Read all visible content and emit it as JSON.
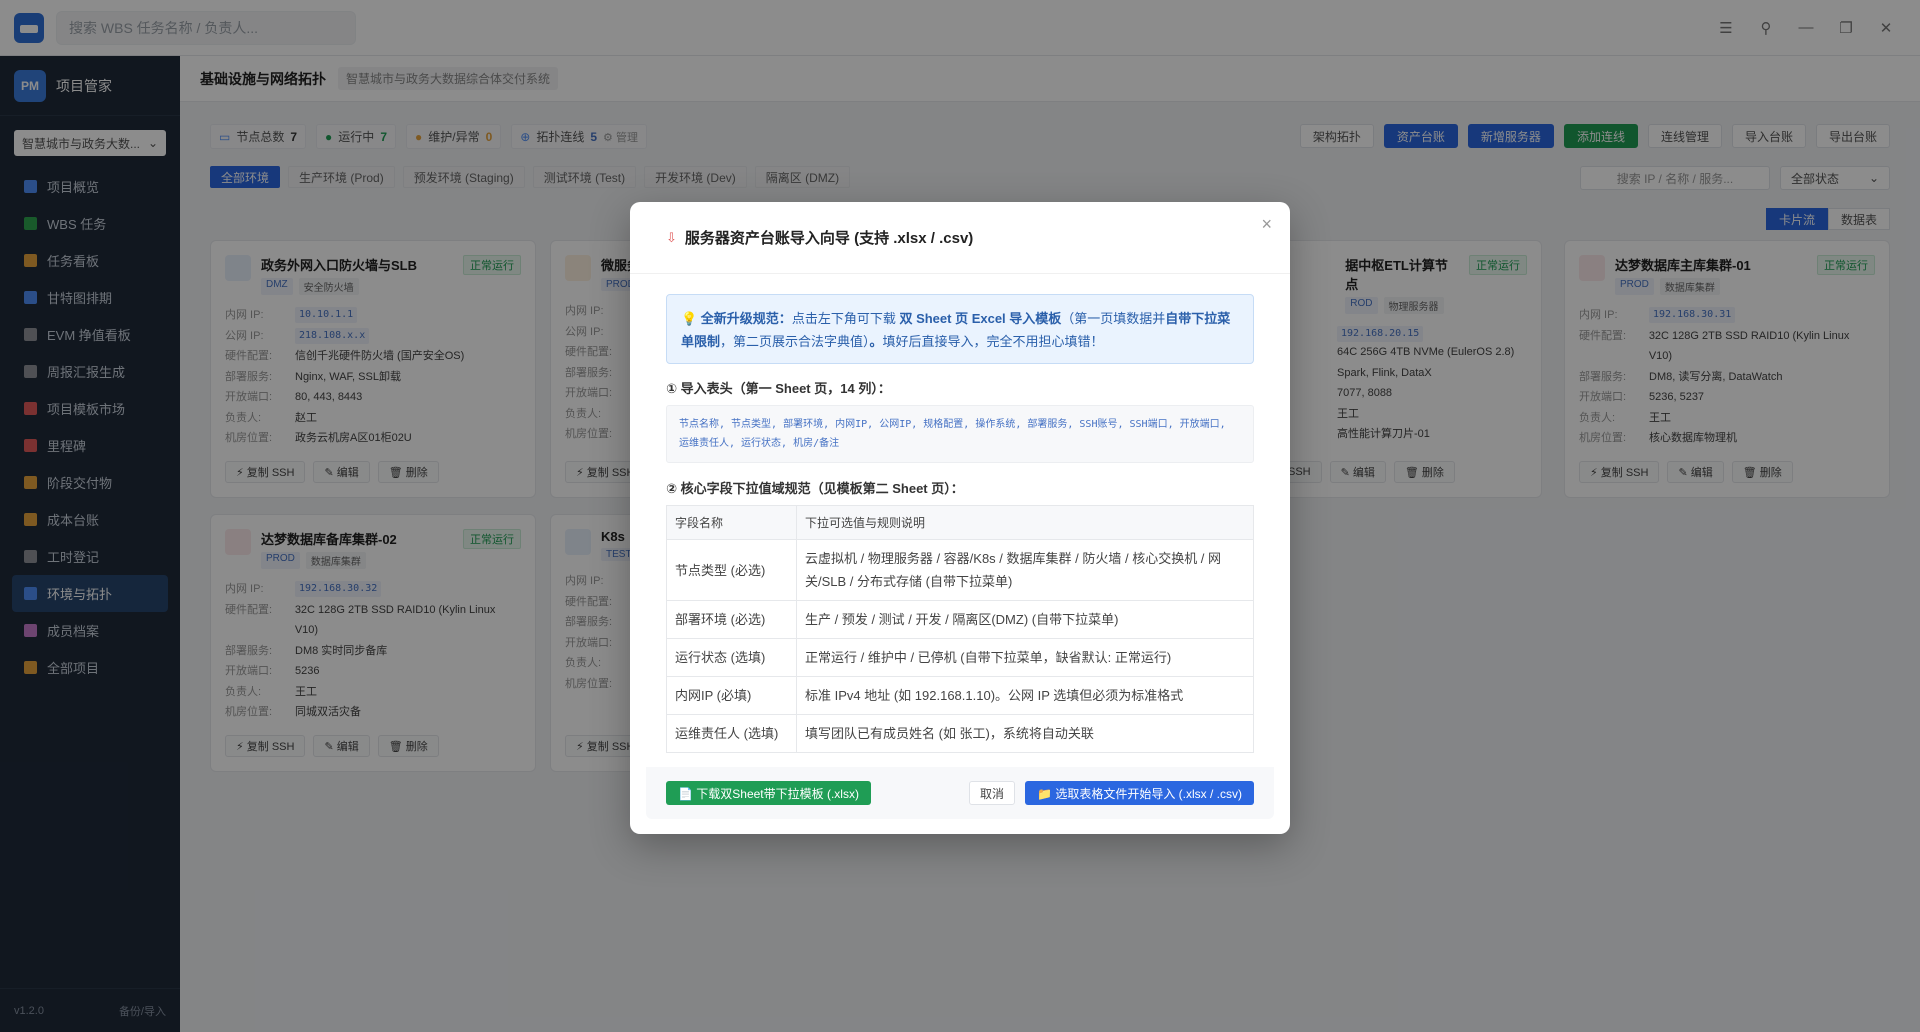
{
  "titlebar": {
    "search_placeholder": "搜索 WBS 任务名称 / 负责人...",
    "ctrl_menu": "☰",
    "ctrl_pin": "⚲",
    "ctrl_min": "—",
    "ctrl_max": "❐",
    "ctrl_close": "✕"
  },
  "sidebar": {
    "brand_logo": "PM",
    "brand_name": "项目管家",
    "project_select": "智慧城市与政务大数...",
    "items": [
      {
        "label": "项目概览",
        "color": "#4f8ef7"
      },
      {
        "label": "WBS 任务",
        "color": "#2ea44f"
      },
      {
        "label": "任务看板",
        "color": "#e6a23c"
      },
      {
        "label": "甘特图排期",
        "color": "#4f8ef7"
      },
      {
        "label": "EVM 挣值看板",
        "color": "#909399"
      },
      {
        "label": "周报汇报生成",
        "color": "#909399"
      },
      {
        "label": "项目模板市场",
        "color": "#e05a5a"
      },
      {
        "label": "里程碑",
        "color": "#e05a5a"
      },
      {
        "label": "阶段交付物",
        "color": "#e6a23c"
      },
      {
        "label": "成本台账",
        "color": "#e6a23c"
      },
      {
        "label": "工时登记",
        "color": "#909399"
      },
      {
        "label": "环境与拓扑",
        "color": "#4f8ef7"
      },
      {
        "label": "成员档案",
        "color": "#c77dcc"
      },
      {
        "label": "全部项目",
        "color": "#e6a23c"
      }
    ],
    "version": "v1.2.0",
    "backup": "备份/导入"
  },
  "page": {
    "title": "基础设施与网络拓扑",
    "subtitle": "智慧城市与政务大数据综合体交付系统"
  },
  "stats": [
    {
      "label": "节点总数",
      "value": "7"
    },
    {
      "label": "运行中",
      "value": "7"
    },
    {
      "label": "维护/异常",
      "value": "0"
    },
    {
      "label": "拓扑连线",
      "value": "5"
    }
  ],
  "stats_manage": "⚙ 管理",
  "toolbar": {
    "arch": "架构拓扑",
    "asset": "资产台账",
    "add_server": "新增服务器",
    "add_link": "添加连线",
    "link_manage": "连线管理",
    "import": "导入台账",
    "export": "导出台账"
  },
  "env_tabs": [
    "全部环境",
    "生产环境 (Prod)",
    "预发环境 (Staging)",
    "测试环境 (Test)",
    "开发环境 (Dev)",
    "隔离区 (DMZ)"
  ],
  "filter": {
    "search_placeholder": "搜索 IP / 名称 / 服务...",
    "status": "全部状态"
  },
  "view": {
    "card": "卡片流",
    "table": "数据表"
  },
  "row_keys": {
    "ip_in": "内网 IP:",
    "ip_out": "公网 IP:",
    "hw": "硬件配置:",
    "svc": "部署服务:",
    "ports": "开放端口:",
    "owner": "负责人:",
    "room": "机房位置:"
  },
  "card_actions": {
    "ssh": "⚡ 复制 SSH",
    "edit": "✎ 编辑",
    "del": "🗑 删除"
  },
  "cards": [
    {
      "title": "政务外网入口防火墙与SLB",
      "env": "DMZ",
      "type": "安全防火墙",
      "status": "正常运行",
      "ip_in": "10.10.1.1",
      "ip_out": "218.108.x.x",
      "hw": "信创千兆硬件防火墙 (国产安全OS)",
      "svc": "Nginx, WAF, SSL卸载",
      "ports": "80, 443, 8443",
      "owner": "赵工",
      "room": "政务云机房A区01柜02U"
    },
    {
      "title": "微服务",
      "env": "PROD"
    },
    {
      "title": "据中枢ETL计算节点",
      "env": "ROD",
      "type": "物理服务器",
      "status": "正常运行",
      "ip_in": "192.168.20.15",
      "hw": "64C 256G 4TB NVMe (EulerOS 2.8)",
      "svc": "Spark, Flink, DataX",
      "ports": "7077, 8088",
      "owner": "王工",
      "room": "高性能计算刀片-01"
    },
    {
      "title": "达梦数据库主库集群-01",
      "env": "PROD",
      "type": "数据库集群",
      "status": "正常运行",
      "ip_in": "192.168.30.31",
      "hw": "32C 128G 2TB SSD RAID10 (Kylin Linux V10)",
      "svc": "DM8, 读写分离, DataWatch",
      "ports": "5236, 5237",
      "owner": "王工",
      "room": "核心数据库物理机"
    },
    {
      "title": "达梦数据库备库集群-02",
      "env": "PROD",
      "type": "数据库集群",
      "status": "正常运行",
      "ip_in": "192.168.30.32",
      "hw": "32C 128G 2TB SSD RAID10 (Kylin Linux V10)",
      "svc": "DM8 实时同步备库",
      "ports": "5236",
      "owner": "王工",
      "room": "同城双活灾备"
    },
    {
      "title": "K8s",
      "env": "TEST"
    }
  ],
  "modal": {
    "title": "服务器资产台账导入向导 (支持 .xlsx / .csv)",
    "close": "×",
    "notice_lead": "💡 全新升级规范：",
    "notice_t1": "点击左下角可下载",
    "notice_b1": "双 Sheet 页 Excel 导入模板",
    "notice_t2": "（第一页填数据并",
    "notice_b2": "自带下拉菜单限制",
    "notice_t3": "，第二页展示合法字典值）",
    "notice_b3": "。",
    "notice_t4": "填好后直接导入，完全不用担心填错！",
    "sec1": "① 导入表头（第一 Sheet 页，14 列）：",
    "headers": "节点名称, 节点类型, 部署环境, 内网IP, 公网IP, 规格配置, 操作系统, 部署服务, SSH账号, SSH端口, 开放端口, 运维责任人, 运行状态, 机房/备注",
    "sec2": "② 核心字段下拉值域规范（见模板第二 Sheet 页）：",
    "th1": "字段名称",
    "th2": "下拉可选值与规则说明",
    "rows": [
      {
        "k": "节点类型 (必选)",
        "v": "云虚拟机 / 物理服务器 / 容器/K8s / 数据库集群 / 防火墙 / 核心交换机 / 网关/SLB / 分布式存储 (自带下拉菜单)"
      },
      {
        "k": "部署环境 (必选)",
        "v": "生产 / 预发 / 测试 / 开发 / 隔离区(DMZ) (自带下拉菜单)"
      },
      {
        "k": "运行状态 (选填)",
        "v": "正常运行 / 维护中 / 已停机 (自带下拉菜单，缺省默认: 正常运行)"
      },
      {
        "k": "内网IP (必填)",
        "v": "标准 IPv4 地址 (如 192.168.1.10)。公网 IP 选填但必须为标准格式"
      },
      {
        "k": "运维责任人 (选填)",
        "v": "填写团队已有成员姓名 (如 张工)，系统将自动关联"
      }
    ],
    "btn_download": "📄 下载双Sheet带下拉模板 (.xlsx)",
    "btn_cancel": "取消",
    "btn_import": "📁 选取表格文件开始导入 (.xlsx / .csv)"
  }
}
